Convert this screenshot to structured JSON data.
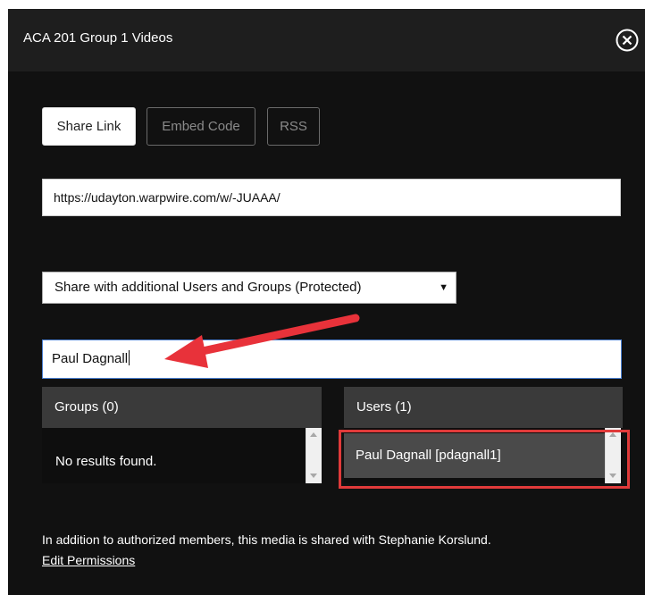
{
  "header": {
    "title": "ACA 201 Group 1 Videos",
    "close_icon": "close-circle-icon"
  },
  "tabs": [
    {
      "label": "Share Link",
      "active": true
    },
    {
      "label": "Embed Code",
      "active": false
    },
    {
      "label": "RSS",
      "active": false
    }
  ],
  "share_url": "https://udayton.warpwire.com/w/-JUAAA/",
  "share_select": {
    "selected": "Share with additional Users and Groups (Protected)"
  },
  "search": {
    "value": "Paul Dagnall"
  },
  "groups_panel": {
    "header": "Groups (0)",
    "empty_text": "No results found."
  },
  "users_panel": {
    "header": "Users (1)",
    "items": [
      {
        "label": "Paul Dagnall [pdagnall1]"
      }
    ]
  },
  "footer": {
    "text": "In addition to authorized members, this media is shared with Stephanie Korslund.",
    "edit_link": "Edit Permissions"
  },
  "colors": {
    "modal_bg": "#111111",
    "annotation_red": "#e03a3a",
    "focus_blue": "#4a7fd0"
  }
}
